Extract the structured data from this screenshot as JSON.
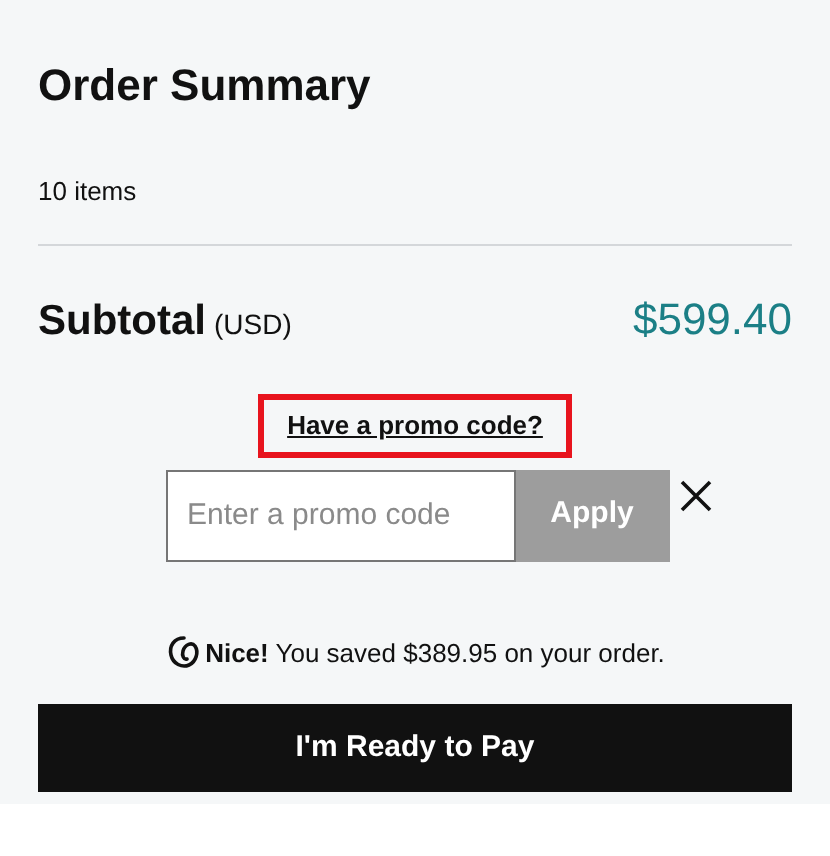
{
  "title": "Order Summary",
  "item_count": "10 items",
  "subtotal": {
    "label": "Subtotal",
    "currency": "(USD)",
    "amount": "$599.40"
  },
  "promo": {
    "link": "Have a promo code?",
    "highlighted": true,
    "placeholder": "Enter a promo code",
    "apply": "Apply",
    "apply_disabled": true
  },
  "savings": "**Nice!** You saved $389.95 on your order.",
  "pay_button": "I'm Ready to Pay"
}
